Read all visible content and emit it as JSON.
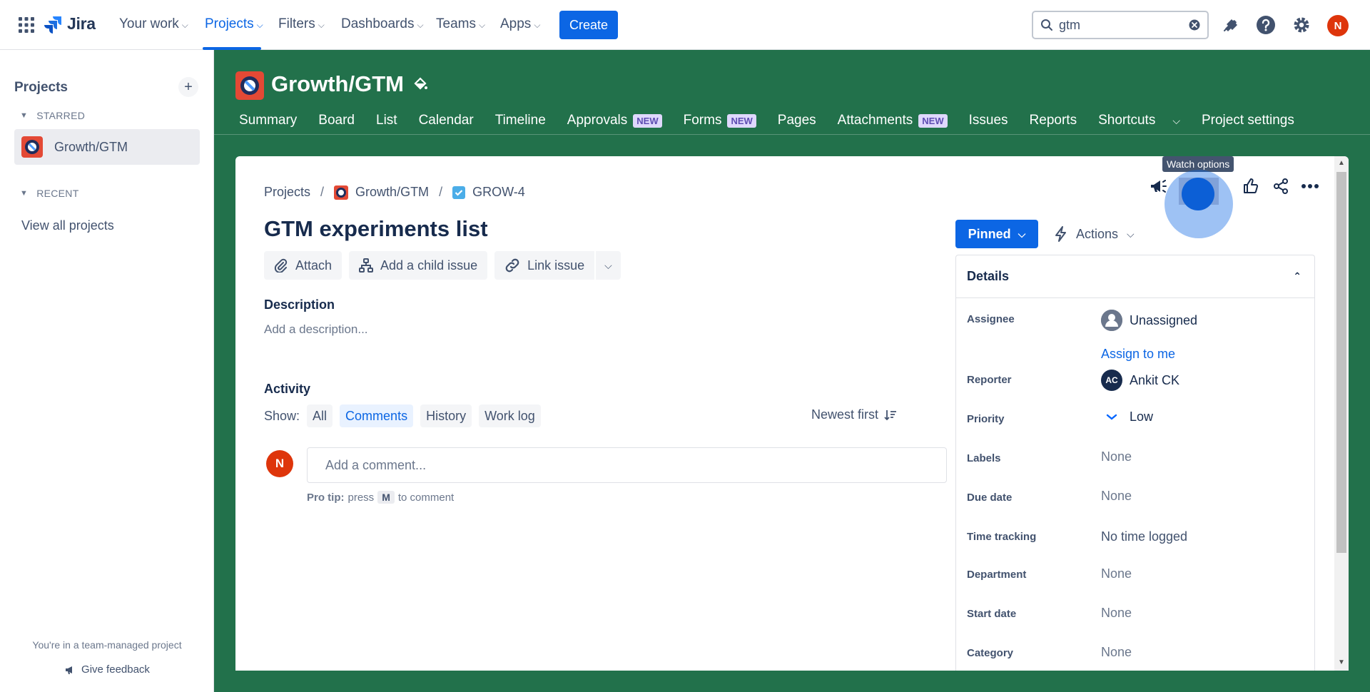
{
  "topnav": {
    "logo": "Jira",
    "items": [
      {
        "label": "Your work"
      },
      {
        "label": "Projects"
      },
      {
        "label": "Filters"
      },
      {
        "label": "Dashboards"
      },
      {
        "label": "Teams"
      },
      {
        "label": "Apps"
      }
    ],
    "create_label": "Create",
    "search_value": "gtm",
    "user_initial": "N",
    "icons": [
      "app-switcher-icon",
      "notifications-icon",
      "help-icon",
      "settings-icon"
    ]
  },
  "sidebar": {
    "title": "Projects",
    "starred_label": "STARRED",
    "starred_project": "Growth/GTM",
    "recent_label": "RECENT",
    "view_all": "View all projects",
    "footer_note": "You're in a team-managed project",
    "feedback": "Give feedback"
  },
  "project": {
    "name": "Growth/GTM",
    "tabs": [
      {
        "label": "Summary",
        "badge": ""
      },
      {
        "label": "Board",
        "badge": ""
      },
      {
        "label": "List",
        "badge": ""
      },
      {
        "label": "Calendar",
        "badge": ""
      },
      {
        "label": "Timeline",
        "badge": ""
      },
      {
        "label": "Approvals",
        "badge": "NEW"
      },
      {
        "label": "Forms",
        "badge": "NEW"
      },
      {
        "label": "Pages",
        "badge": ""
      },
      {
        "label": "Attachments",
        "badge": "NEW"
      },
      {
        "label": "Issues",
        "badge": ""
      },
      {
        "label": "Reports",
        "badge": ""
      },
      {
        "label": "Shortcuts",
        "badge": ""
      },
      {
        "label": "Project settings",
        "badge": ""
      }
    ],
    "colors": {
      "header_bg": "#22714b",
      "accent": "#0c66e4"
    }
  },
  "issue": {
    "breadcrumb": {
      "root": "Projects",
      "project": "Growth/GTM",
      "key": "GROW-4"
    },
    "title": "GTM experiments list",
    "toolbar": {
      "attach": "Attach",
      "child": "Add a child issue",
      "link": "Link issue"
    },
    "description_label": "Description",
    "description_placeholder": "Add a description...",
    "activity_label": "Activity",
    "show_label": "Show:",
    "filters": [
      "All",
      "Comments",
      "History",
      "Work log"
    ],
    "selected_filter": "Comments",
    "sort_label": "Newest first",
    "comment_placeholder": "Add a comment...",
    "protip": {
      "lead": "Pro tip:",
      "press": "press",
      "key": "M",
      "tail": "to comment"
    }
  },
  "side": {
    "pinned_label": "Pinned",
    "actions_label": "Actions",
    "watch_tooltip": "Watch options",
    "details_title": "Details",
    "fields": [
      {
        "label": "Assignee",
        "value": "Unassigned"
      },
      {
        "label": "Reporter",
        "value": "Ankit CK",
        "initials": "AC"
      },
      {
        "label": "Priority",
        "value": "Low"
      },
      {
        "label": "Labels",
        "value": "None"
      },
      {
        "label": "Due date",
        "value": "None"
      },
      {
        "label": "Time tracking",
        "value": "No time logged"
      },
      {
        "label": "Department",
        "value": "None"
      },
      {
        "label": "Start date",
        "value": "None"
      },
      {
        "label": "Category",
        "value": "None"
      }
    ],
    "assign_to_me": "Assign to me"
  }
}
